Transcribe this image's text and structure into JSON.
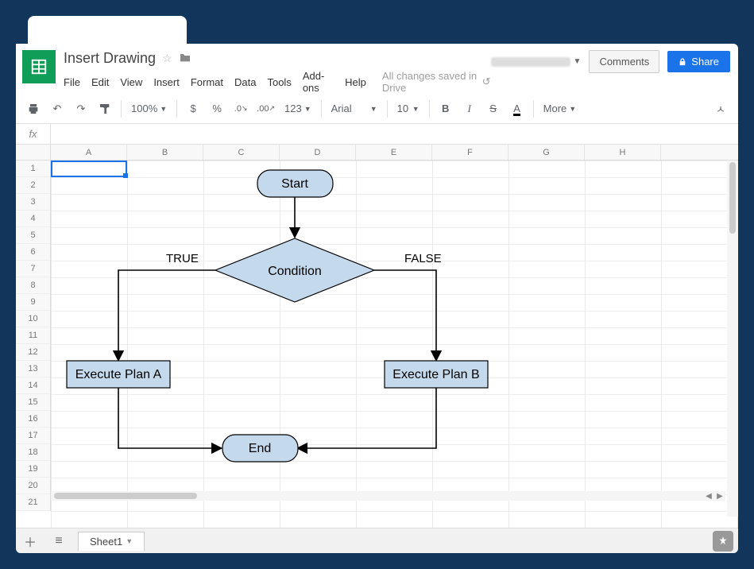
{
  "doc": {
    "title": "Insert Drawing",
    "save_status": "All changes saved in Drive"
  },
  "menu": {
    "file": "File",
    "edit": "Edit",
    "view": "View",
    "insert": "Insert",
    "format": "Format",
    "data": "Data",
    "tools": "Tools",
    "addons": "Add-ons",
    "help": "Help"
  },
  "actions": {
    "comments": "Comments",
    "share": "Share"
  },
  "toolbar": {
    "zoom": "100%",
    "currency": "$",
    "percent": "%",
    "dec_dec": ".0",
    "inc_dec": ".00",
    "number_fmt": "123",
    "font": "Arial",
    "font_size": "10",
    "bold": "B",
    "italic": "I",
    "strike": "S",
    "text_color": "A",
    "more": "More"
  },
  "formula": {
    "label": "fx",
    "value": ""
  },
  "columns": [
    "A",
    "B",
    "C",
    "D",
    "E",
    "F",
    "G",
    "H"
  ],
  "rows": [
    "1",
    "2",
    "3",
    "4",
    "5",
    "6",
    "7",
    "8",
    "9",
    "10",
    "11",
    "12",
    "13",
    "14",
    "15",
    "16",
    "17",
    "18",
    "19",
    "20",
    "21"
  ],
  "flowchart": {
    "start": "Start",
    "condition": "Condition",
    "true_label": "TRUE",
    "false_label": "FALSE",
    "plan_a": "Execute Plan A",
    "plan_b": "Execute Plan B",
    "end": "End"
  },
  "sheet": {
    "name": "Sheet1"
  },
  "chart_data": {
    "type": "flowchart",
    "nodes": [
      {
        "id": "start",
        "shape": "terminator",
        "label": "Start"
      },
      {
        "id": "cond",
        "shape": "decision",
        "label": "Condition"
      },
      {
        "id": "a",
        "shape": "process",
        "label": "Execute Plan A"
      },
      {
        "id": "b",
        "shape": "process",
        "label": "Execute Plan B"
      },
      {
        "id": "end",
        "shape": "terminator",
        "label": "End"
      }
    ],
    "edges": [
      {
        "from": "start",
        "to": "cond"
      },
      {
        "from": "cond",
        "to": "a",
        "label": "TRUE"
      },
      {
        "from": "cond",
        "to": "b",
        "label": "FALSE"
      },
      {
        "from": "a",
        "to": "end"
      },
      {
        "from": "b",
        "to": "end"
      }
    ]
  }
}
